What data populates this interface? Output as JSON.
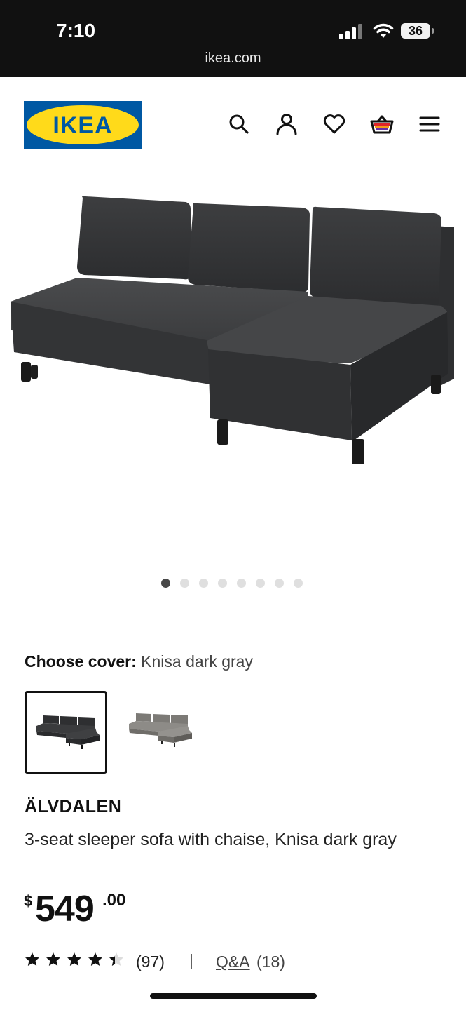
{
  "status_bar": {
    "time": "7:10",
    "url": "ikea.com",
    "battery": "36"
  },
  "header": {
    "logo_text": "IKEA",
    "icons": [
      "search-icon",
      "profile-icon",
      "heart-icon",
      "basket-icon",
      "menu-icon"
    ],
    "brand_blue": "#0058a3",
    "brand_yellow": "#ffda1a"
  },
  "gallery": {
    "image_count": 8,
    "active_index": 0
  },
  "cover": {
    "label": "Choose cover:",
    "value": "Knisa dark gray",
    "options": [
      "Knisa dark gray",
      "Knisa light gray"
    ],
    "selected_index": 0
  },
  "product": {
    "name": "ÄLVDALEN",
    "description": "3-seat sleeper sofa with chaise, Knisa dark gray",
    "price_currency": "$",
    "price_integer": "549",
    "price_decimal": ".00"
  },
  "rating": {
    "stars": 4,
    "max": 5,
    "review_count": "(97)",
    "separator": "|",
    "qa_label": "Q&A",
    "qa_count": "(18)"
  }
}
